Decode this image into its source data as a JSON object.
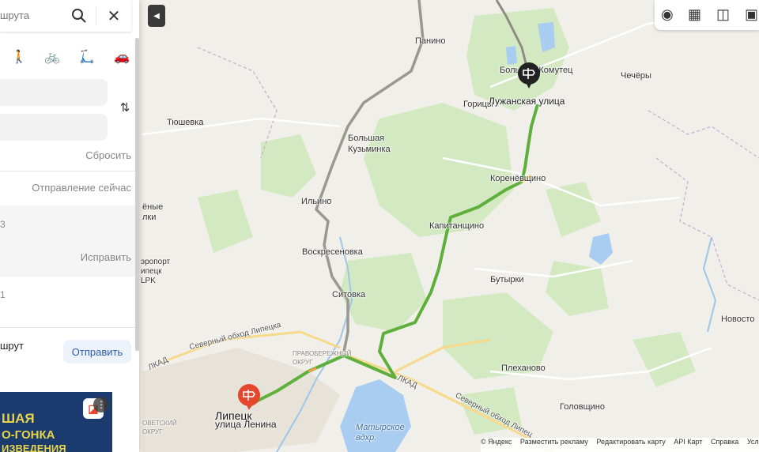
{
  "panel": {
    "search_text": "шрута",
    "search_icon": "search-icon",
    "close_icon": "close-icon",
    "modes": [
      "walk-icon",
      "bike-icon",
      "scooter-icon",
      "car-icon"
    ],
    "swap_icon": "swap-icon",
    "reset_label": "Сбросить",
    "departure_label": "Отправление сейчас",
    "item1_num": "3",
    "fix_label": "Исправить",
    "item2_num": "1",
    "route_label": "шрут",
    "send_label": "Отправить",
    "ad_line1": "ШАЯ",
    "ad_line2": "О-ГОНКА",
    "ad_line3": "ИЗВЕДЕНИЯ"
  },
  "map": {
    "labels": {
      "panino": "Панино",
      "bolshoy_komutets": "Большой Комутец",
      "chechery": "Чечёры",
      "goritsy": "Горицы",
      "luzhanskaya": "Лужанская улица",
      "tyushevka": "Тюшевка",
      "bolshaya_kuzminka": "Большая Кузьминка",
      "koreneshchino": "Коренёвщино",
      "ilyino": "Ильино",
      "kapitanshchino": "Капитанщино",
      "chenye_polki": "ёные лки",
      "airport": "эропорт ипецк LPK",
      "voskresenovka": "Воскресеновка",
      "butyrki": "Бутырки",
      "sitovka": "Ситовка",
      "novosto": "Новосто",
      "severny_obhod": "Северный обход Липецка",
      "pravoberezhny": "ПРАВОБЕРЕЖНЫЙ ОКРУГ",
      "lkad": "ЛКАД",
      "plekhanovo": "Плеханово",
      "lkad2": "ЛКАД",
      "lipetsk": "Липецк",
      "sovetsky": "ОВЕТСКИЙ ОКРУГ",
      "ulitsa_lenina": "улица Ленина",
      "matyrskoe": "Матырское вдхр.",
      "severny_obhod2": "Северный обход Липец",
      "golovshchino": "Головщино"
    }
  },
  "toolbar": {
    "icons": [
      "layers-icon",
      "map-type-icon",
      "camera-icon",
      "transport-icon"
    ]
  },
  "footer": {
    "copyright": "© Яндекс",
    "ads": "Разместить рекламу",
    "edit": "Редактировать карту",
    "api": "API Карт",
    "help": "Справка",
    "terms": "Услов"
  }
}
